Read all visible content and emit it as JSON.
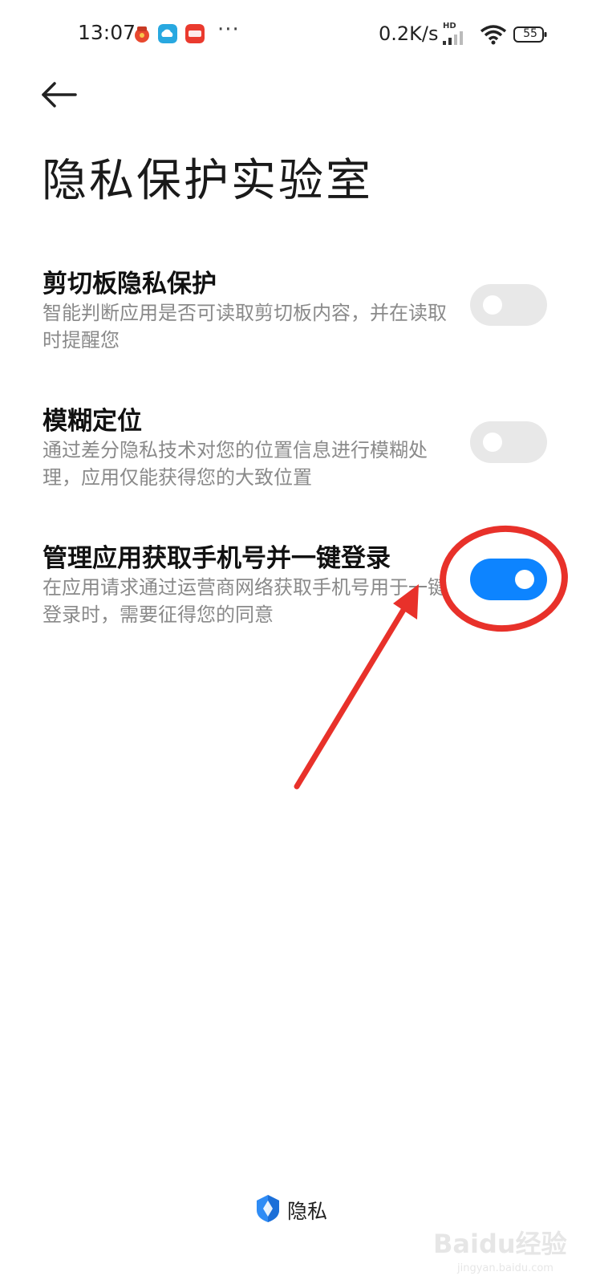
{
  "status_bar": {
    "time": "13:07",
    "overflow": "···",
    "network_speed": "0.2K/s",
    "network_type": "HD",
    "battery_level": "55",
    "notification_icons": [
      "red-envelope-icon",
      "cloud-app-icon",
      "community-app-icon"
    ]
  },
  "header": {
    "back_icon": "arrow-left-icon",
    "title": "隐私保护实验室"
  },
  "settings": [
    {
      "title": "剪切板隐私保护",
      "description": "智能判断应用是否可读取剪切板内容，并在读取时提醒您",
      "enabled": false
    },
    {
      "title": "模糊定位",
      "description": "通过差分隐私技术对您的位置信息进行模糊处理，应用仅能获得您的大致位置",
      "enabled": false
    },
    {
      "title": "管理应用获取手机号并一键登录",
      "description": "在应用请求通过运营商网络获取手机号用于一键登录时，需要征得您的同意",
      "enabled": true
    }
  ],
  "footer": {
    "icon": "shield-logo-icon",
    "label": "隐私"
  },
  "watermark": {
    "text": "Baidu经验",
    "subtext": "jingyan.baidu.com"
  },
  "colors": {
    "toggle_on": "#0d84ff",
    "toggle_off": "#e8e8e8",
    "annotation": "#e8312a"
  }
}
